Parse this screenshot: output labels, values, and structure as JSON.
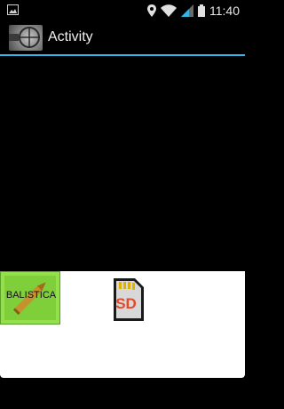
{
  "status_bar": {
    "time": "11:40",
    "icons": [
      "image-notification-icon",
      "location-icon",
      "wifi-icon",
      "signal-icon",
      "battery-icon"
    ]
  },
  "action_bar": {
    "title": "Activity",
    "logo_icon": "scope-icon"
  },
  "panel": {
    "balistica_label": "BALISTICA",
    "sd_label": "SD"
  }
}
